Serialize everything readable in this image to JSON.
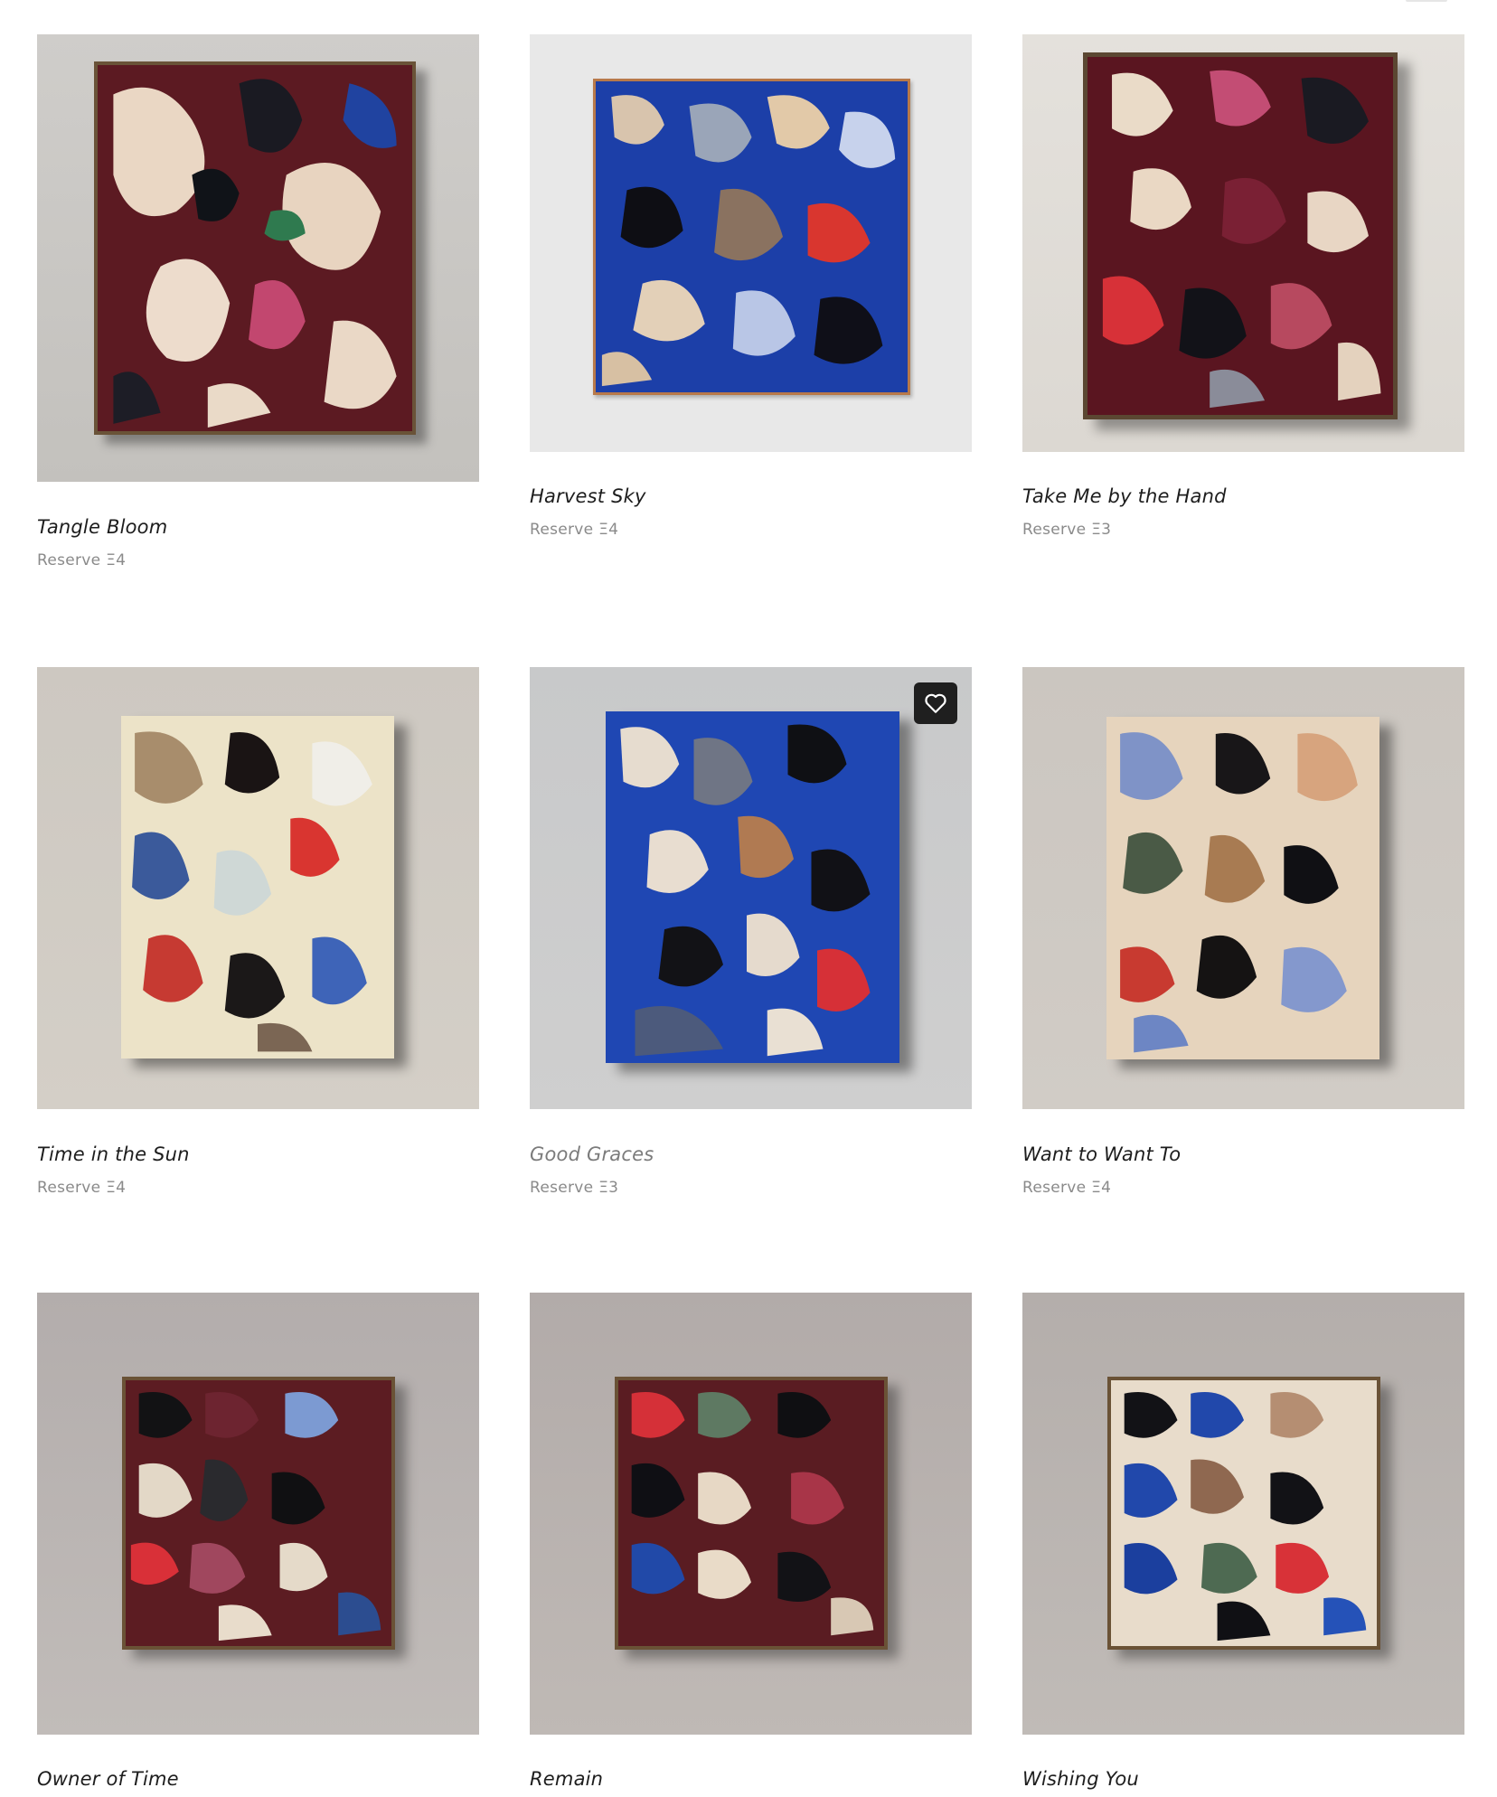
{
  "colors": {
    "page_bg": "#ffffff",
    "title_text": "#1d1d1d",
    "title_muted": "#7b7b7b",
    "price_text": "#8a8a8a",
    "favorite_bg": "#1f1f1f"
  },
  "artworks": [
    {
      "title": "Tangle Bloom",
      "price": "Reserve Ξ4"
    },
    {
      "title": "Harvest Sky",
      "price": "Reserve Ξ4"
    },
    {
      "title": "Take Me by the Hand",
      "price": "Reserve Ξ3"
    },
    {
      "title": "Time in the Sun",
      "price": "Reserve Ξ4"
    },
    {
      "title": "Good Graces",
      "price": "Reserve Ξ3",
      "hovered": true,
      "favorite_icon": "heart-outline-icon"
    },
    {
      "title": "Want to Want To",
      "price": "Reserve Ξ4"
    },
    {
      "title": "Owner of Time"
    },
    {
      "title": "Remain"
    },
    {
      "title": "Wishing You"
    }
  ]
}
